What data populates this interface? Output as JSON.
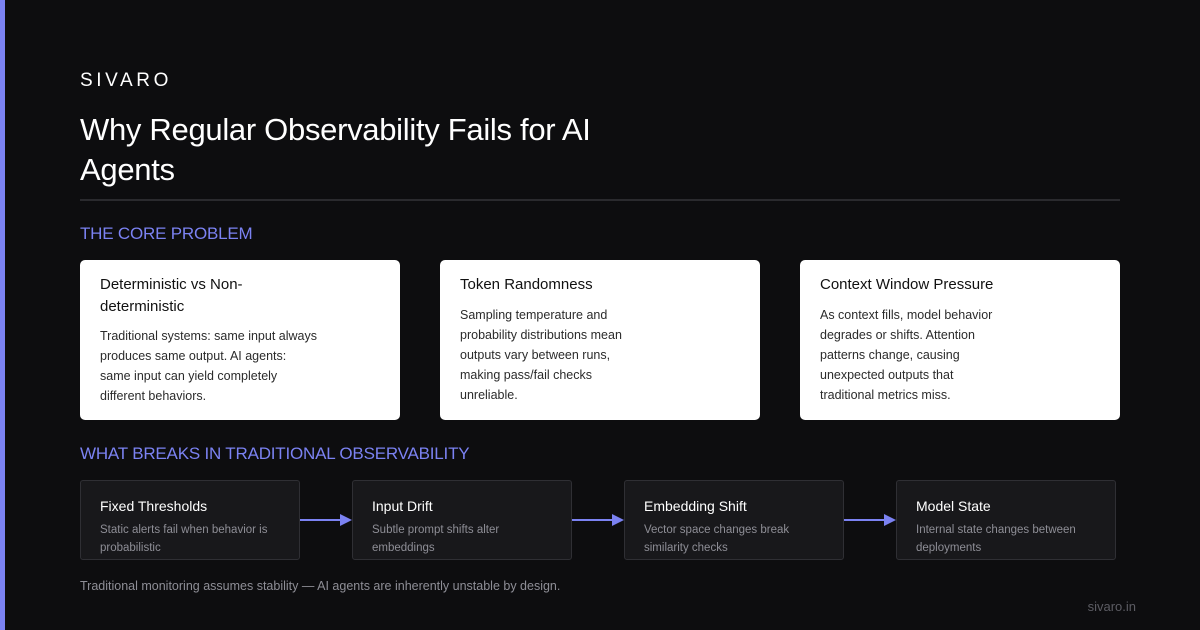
{
  "brand": "SIVARO",
  "title": "Why Regular Observability Fails for AI Agents",
  "sections": {
    "core": "THE CORE PROBLEM",
    "breaks": "WHAT BREAKS IN TRADITIONAL OBSERVABILITY"
  },
  "cards": [
    {
      "title": "Deterministic vs Non-deterministic",
      "body": "Traditional systems: same input always produces same output. AI agents: same input can yield completely different behaviors."
    },
    {
      "title": "Token Randomness",
      "body": "Sampling temperature and probability distributions mean outputs vary between runs, making pass/fail checks unreliable."
    },
    {
      "title": "Context Window Pressure",
      "body": "As context fills, model behavior degrades or shifts. Attention patterns change, causing unexpected outputs that traditional metrics miss."
    }
  ],
  "flow": [
    {
      "title": "Fixed Thresholds",
      "body": "Static alerts fail when behavior is probabilistic"
    },
    {
      "title": "Input Drift",
      "body": "Subtle prompt shifts alter embeddings"
    },
    {
      "title": "Embedding Shift",
      "body": "Vector space changes break similarity checks"
    },
    {
      "title": "Model State",
      "body": "Internal state changes between deployments"
    }
  ],
  "footnote": "Traditional monitoring assumes stability — AI agents are inherently unstable by design.",
  "site": "sivaro.in",
  "colors": {
    "accent": "#7b82f2",
    "background": "#0d0d0f",
    "card": "#ffffff",
    "flow_box": "#18181b"
  }
}
